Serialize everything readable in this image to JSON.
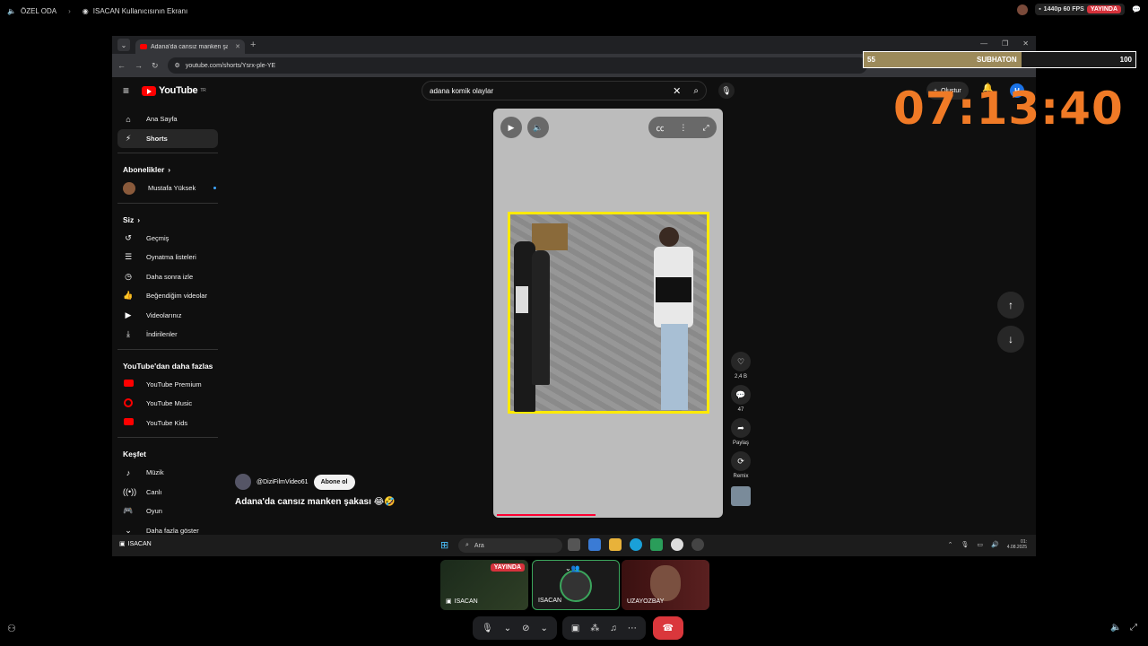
{
  "topbar": {
    "room": "ÖZEL ODA",
    "screen_title": "ISACAN Kullanıcısının Ekranı",
    "quality": "1440p 60 FPS",
    "live": "YAYINDA"
  },
  "browser": {
    "tab_title": "Adana'da cansız manken şakası",
    "url": "youtube.com/shorts/Ysrx-ple-YE"
  },
  "youtube": {
    "logo": "YouTube",
    "region": "TR",
    "search_value": "adana komik olaylar",
    "create_label": "Oluştur",
    "user_initial": "H",
    "sidebar": {
      "home": "Ana Sayfa",
      "shorts": "Shorts",
      "subs_header": "Abonelikler",
      "sub_channel": "Mustafa Yüksek",
      "you_header": "Siz",
      "history": "Geçmiş",
      "playlists": "Oynatma listeleri",
      "watch_later": "Daha sonra izle",
      "liked": "Beğendiğim videolar",
      "your_videos": "Videolarınız",
      "downloads": "İndirilenler",
      "more_header": "YouTube'dan daha fazlası",
      "premium": "YouTube Premium",
      "music": "YouTube Music",
      "kids": "YouTube Kids",
      "explore_header": "Keşfet",
      "music_cat": "Müzik",
      "live_cat": "Canlı",
      "gaming_cat": "Oyun",
      "show_more": "Daha fazla göster"
    },
    "short": {
      "likes": "2,4 B",
      "comments": "47",
      "share": "Paylaş",
      "remix": "Remix",
      "channel": "@DiziFilmVideo61",
      "subscribe": "Abone ol",
      "title": "Adana'da cansız manken şakası 😂🤣",
      "progress_fraction": 0.43
    }
  },
  "taskbar": {
    "presenter": "ISACAN",
    "search": "Ara",
    "date": "4.08.2025",
    "time": "01:"
  },
  "overlay": {
    "subathon_left": "55",
    "subathon_label": "SUBHATON",
    "subathon_right": "100",
    "subathon_fill": 0.58,
    "timer": "07:13:40"
  },
  "participants": [
    {
      "name": "ISACAN",
      "live": "YAYINDA"
    },
    {
      "name": "ISACAN"
    },
    {
      "name": "UZAYOZBAY"
    }
  ]
}
